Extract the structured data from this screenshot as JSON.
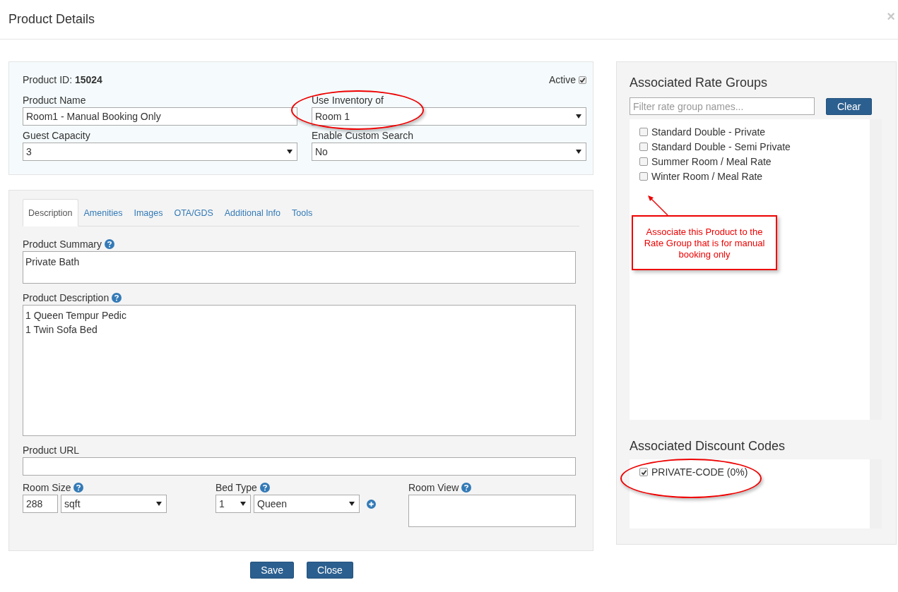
{
  "header": {
    "title": "Product Details",
    "close": "×"
  },
  "product": {
    "id_label": "Product ID:",
    "id": "15024",
    "active_label": "Active",
    "active": true,
    "fields": [
      {
        "label": "Product Name",
        "kind": "text",
        "value": "Room1 - Manual Booking Only"
      },
      {
        "label": "Use Inventory of",
        "kind": "select",
        "value": "Room 1"
      },
      {
        "label": "Guest Capacity",
        "kind": "select",
        "value": "3"
      },
      {
        "label": "Enable Custom Search",
        "kind": "select",
        "value": "No"
      }
    ]
  },
  "tabs": [
    {
      "label": "Description",
      "selected": true
    },
    {
      "label": "Amenities",
      "selected": false
    },
    {
      "label": "Images",
      "selected": false
    },
    {
      "label": "OTA/GDS",
      "selected": false
    },
    {
      "label": "Additional Info",
      "selected": false
    },
    {
      "label": "Tools",
      "selected": false
    }
  ],
  "summary": {
    "label": "Product Summary",
    "value": "Private Bath"
  },
  "description": {
    "label": "Product Description",
    "value": "1 Queen Tempur Pedic\n1 Twin Sofa Bed"
  },
  "url": {
    "label": "Product URL"
  },
  "room_size": {
    "label": "Room Size",
    "value": "288",
    "unit": "sqft"
  },
  "bed_type": {
    "label": "Bed Type",
    "count": "1",
    "type": "Queen"
  },
  "room_view": {
    "label": "Room View"
  },
  "buttons": [
    "Save",
    "Close"
  ],
  "rate_groups": {
    "title": "Associated Rate Groups",
    "filter_placeholder": "Filter rate group names...",
    "clear": "Clear",
    "items": [
      {
        "label": "Standard Double - Private",
        "checked": false
      },
      {
        "label": "Standard Double - Semi Private",
        "checked": false
      },
      {
        "label": "Summer Room / Meal Rate",
        "checked": false
      },
      {
        "label": "Winter Room / Meal Rate",
        "checked": false
      }
    ]
  },
  "discount_codes": {
    "title": "Associated Discount Codes",
    "items": [
      {
        "label": "PRIVATE-CODE (0%)",
        "checked": true
      }
    ]
  },
  "callout": "Associate this Product to the Rate Group that is for manual booking only"
}
